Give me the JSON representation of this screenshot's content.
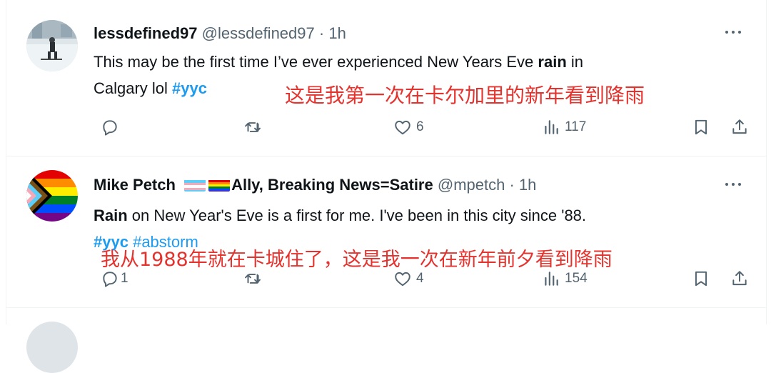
{
  "tweets": [
    {
      "display_name": "lessdefined97",
      "handle": "@lessdefined97",
      "separator": "·",
      "time": "1h",
      "text_parts": [
        "This may be the first time I’ve ever experienced New Years Eve ",
        "rain",
        " in",
        "Calgary lol ",
        "#yyc"
      ],
      "annotation": "这是我第一次在卡尔加里的新年看到降雨",
      "reply_count": "",
      "retweet_count": "",
      "like_count": "6",
      "view_count": "117"
    },
    {
      "display_name": "Mike Petch",
      "name_suffix": "Ally, Breaking News=Satire",
      "handle": "@mpetch",
      "separator": "·",
      "time": "1h",
      "text_parts": [
        "Rain",
        " on New Year's Eve is a first for me. I've been in this city since '88.",
        "#yyc",
        "#abstorm"
      ],
      "annotation": "我从1988年就在卡城住了，这是我一次在新年前夕看到降雨",
      "reply_count": "1",
      "retweet_count": "",
      "like_count": "4",
      "view_count": "154"
    }
  ],
  "colors": {
    "accent": "#1d9bf0",
    "annotation": "#e5322d",
    "muted": "#536471"
  },
  "icons": [
    "reply-icon",
    "retweet-icon",
    "like-icon",
    "views-icon",
    "bookmark-icon",
    "share-icon",
    "more-icon"
  ]
}
